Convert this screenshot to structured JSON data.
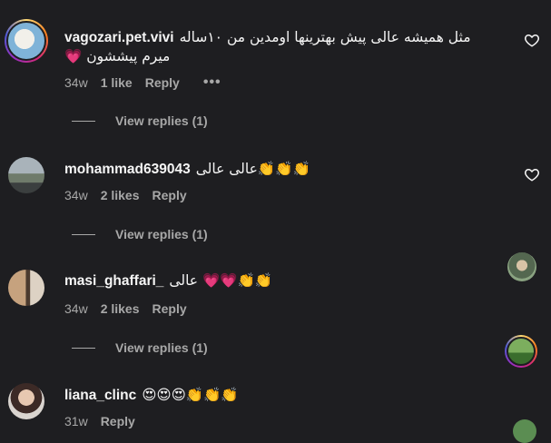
{
  "comments": [
    {
      "username": "vagozari.pet.vivi",
      "text_line1": "مثل همیشه عالی پیش بهترینها اومدین من ۱۰ساله",
      "text_line2": "میرم پیششون 💗",
      "time": "34w",
      "likes": "1 like",
      "reply": "Reply",
      "more": "•••",
      "view_replies": "View replies (1)"
    },
    {
      "username": "mohammad639043",
      "text": "عالی عالی👏👏👏",
      "time": "34w",
      "likes": "2 likes",
      "reply": "Reply",
      "view_replies": "View replies (1)"
    },
    {
      "username": "masi_ghaffari_",
      "text": "عالی 💗💗👏👏",
      "time": "34w",
      "likes": "2 likes",
      "reply": "Reply",
      "view_replies": "View replies (1)"
    },
    {
      "username": "liana_clinc",
      "text": "😍😍😍👏👏👏",
      "time": "31w",
      "reply": "Reply"
    }
  ],
  "icons": {
    "like": "heart-outline-icon",
    "avatar_ring_colors": [
      "#feda75",
      "#fa7e1e",
      "#d62976",
      "#962fbf",
      "#4f5bd5"
    ]
  }
}
